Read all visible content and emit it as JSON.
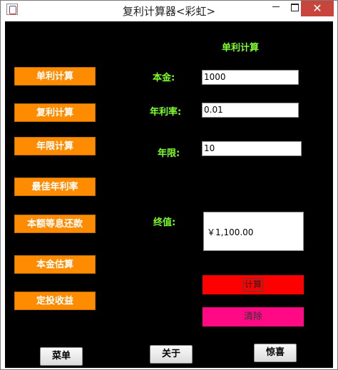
{
  "window": {
    "title": "复利计算器<彩虹>",
    "minimize": "—",
    "close": "✕"
  },
  "sidebar": {
    "items": [
      "单利计算",
      "复利计算",
      "年限计算",
      "最佳年利率",
      "本额等息还款",
      "本金估算",
      "定投收益"
    ]
  },
  "form": {
    "heading": "单利计算",
    "principal_label": "本金:",
    "principal_value": "1000",
    "rate_label": "年利率:",
    "rate_value": "0.01",
    "years_label": "年限:",
    "years_value": "10",
    "result_label": "终值:",
    "result_value": "￥1,100.00",
    "calc_label": "计算",
    "clear_label": "清除"
  },
  "footer": {
    "menu_label": "菜单",
    "about_label": "关于",
    "surprise_label": "惊喜"
  },
  "colors": {
    "accent_orange": "#ff8c00",
    "label_green": "#7fff2a",
    "calc_red": "#ff0000",
    "clear_pink": "#ff0a84"
  }
}
